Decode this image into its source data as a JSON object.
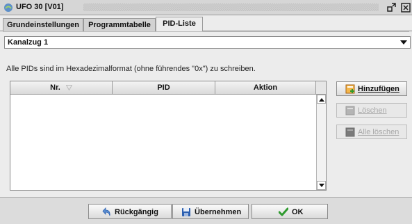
{
  "window": {
    "title": "UFO 30 [V01]",
    "icons": {
      "app": "ufo-app-icon",
      "restore": "restore-window-icon",
      "close": "close-window-icon"
    }
  },
  "tabs": [
    {
      "label": "Grundeinstellungen",
      "active": false
    },
    {
      "label": "Programmtabelle",
      "active": false
    },
    {
      "label": "PID-Liste",
      "active": true
    }
  ],
  "combo": {
    "selected": "Kanalzug 1",
    "icon": "dropdown-arrow-icon"
  },
  "hint": "Alle PIDs sind im Hexadezimalformat (ohne führendes \"0x\") zu schreiben.",
  "table": {
    "columns": [
      "Nr.",
      "PID",
      "Aktion"
    ],
    "rows": []
  },
  "side_buttons": {
    "add": {
      "label": "Hinzufügen",
      "enabled": true,
      "icon": "add-item-icon"
    },
    "delete": {
      "label": "Löschen",
      "enabled": false,
      "icon": "delete-icon"
    },
    "delete_all": {
      "label": "Alle löschen",
      "enabled": false,
      "icon": "delete-all-icon"
    }
  },
  "footer": {
    "undo": {
      "label": "Rückgängig",
      "icon": "undo-icon"
    },
    "apply": {
      "label": "Übernehmen",
      "icon": "save-icon"
    },
    "ok": {
      "label": "OK",
      "icon": "checkmark-icon"
    }
  },
  "colors": {
    "ok_green": "#2e9a2e",
    "apply_blue": "#2b5fb0",
    "add_orange": "#e08a20"
  }
}
